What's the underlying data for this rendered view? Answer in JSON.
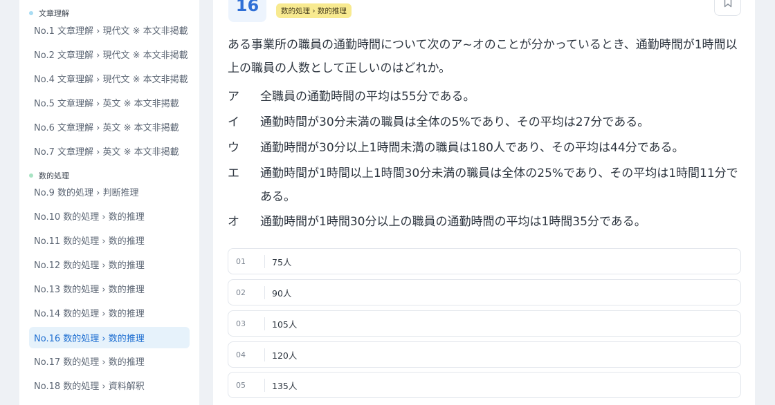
{
  "sidebar": {
    "sections": [
      {
        "label": "文章理解",
        "color": "#a9dcf3"
      },
      {
        "label": "数的処理",
        "color": "#a8e3c3"
      }
    ],
    "items": [
      {
        "label": "No.1 文章理解 › 現代文 ※ 本文非掲載"
      },
      {
        "label": "No.2 文章理解 › 現代文 ※ 本文非掲載"
      },
      {
        "label": "No.4 文章理解 › 現代文 ※ 本文非掲載"
      },
      {
        "label": "No.5 文章理解 › 英文 ※ 本文非掲載"
      },
      {
        "label": "No.6 文章理解 › 英文 ※ 本文非掲載"
      },
      {
        "label": "No.7 文章理解 › 英文 ※ 本文非掲載"
      },
      {
        "label": "No.9 数的処理 › 判断推理"
      },
      {
        "label": "No.10 数的処理 › 数的推理"
      },
      {
        "label": "No.11 数的処理 › 数的推理"
      },
      {
        "label": "No.12 数的処理 › 数的推理"
      },
      {
        "label": "No.13 数的処理 › 数的推理"
      },
      {
        "label": "No.14 数的処理 › 数的推理"
      },
      {
        "label": "No.16 数的処理 › 数的推理"
      },
      {
        "label": "No.17 数的処理 › 数的推理"
      },
      {
        "label": "No.18 数的処理 › 資料解釈"
      }
    ],
    "active_item": "No.16 数的処理 › 数的推理"
  },
  "question": {
    "number": "16",
    "category": "数的処理 › 数的推理",
    "text": "ある事業所の職員の通勤時間について次のア~オのことが分かっているとき、通勤時間が1時間以上の職員の人数として正しいのはどれか。",
    "conditions": [
      {
        "mark": "ア",
        "text": "全職員の通勤時間の平均は55分である。"
      },
      {
        "mark": "イ",
        "text": "通勤時間が30分未満の職員は全体の5%であり、その平均は27分である。"
      },
      {
        "mark": "ウ",
        "text": "通勤時間が30分以上1時間未満の職員は180人であり、その平均は44分である。"
      },
      {
        "mark": "エ",
        "text": "通勤時間が1時間以上1時間30分未満の職員は全体の25%であり、その平均は1時間11分である。"
      },
      {
        "mark": "オ",
        "text": "通勤時間が1時間30分以上の職員の通勤時間の平均は1時間35分である。"
      }
    ],
    "choices": [
      {
        "num": "01",
        "value": "75人"
      },
      {
        "num": "02",
        "value": "90人"
      },
      {
        "num": "03",
        "value": "105人"
      },
      {
        "num": "04",
        "value": "120人"
      },
      {
        "num": "05",
        "value": "135人"
      }
    ]
  },
  "icons": {
    "bookmark": "bookmark-icon"
  },
  "colors": {
    "accent": "#1f6fd1",
    "active_bg": "#e6f2fb",
    "tag_bg": "#f8ea90",
    "number_bg": "#edf4fd"
  }
}
